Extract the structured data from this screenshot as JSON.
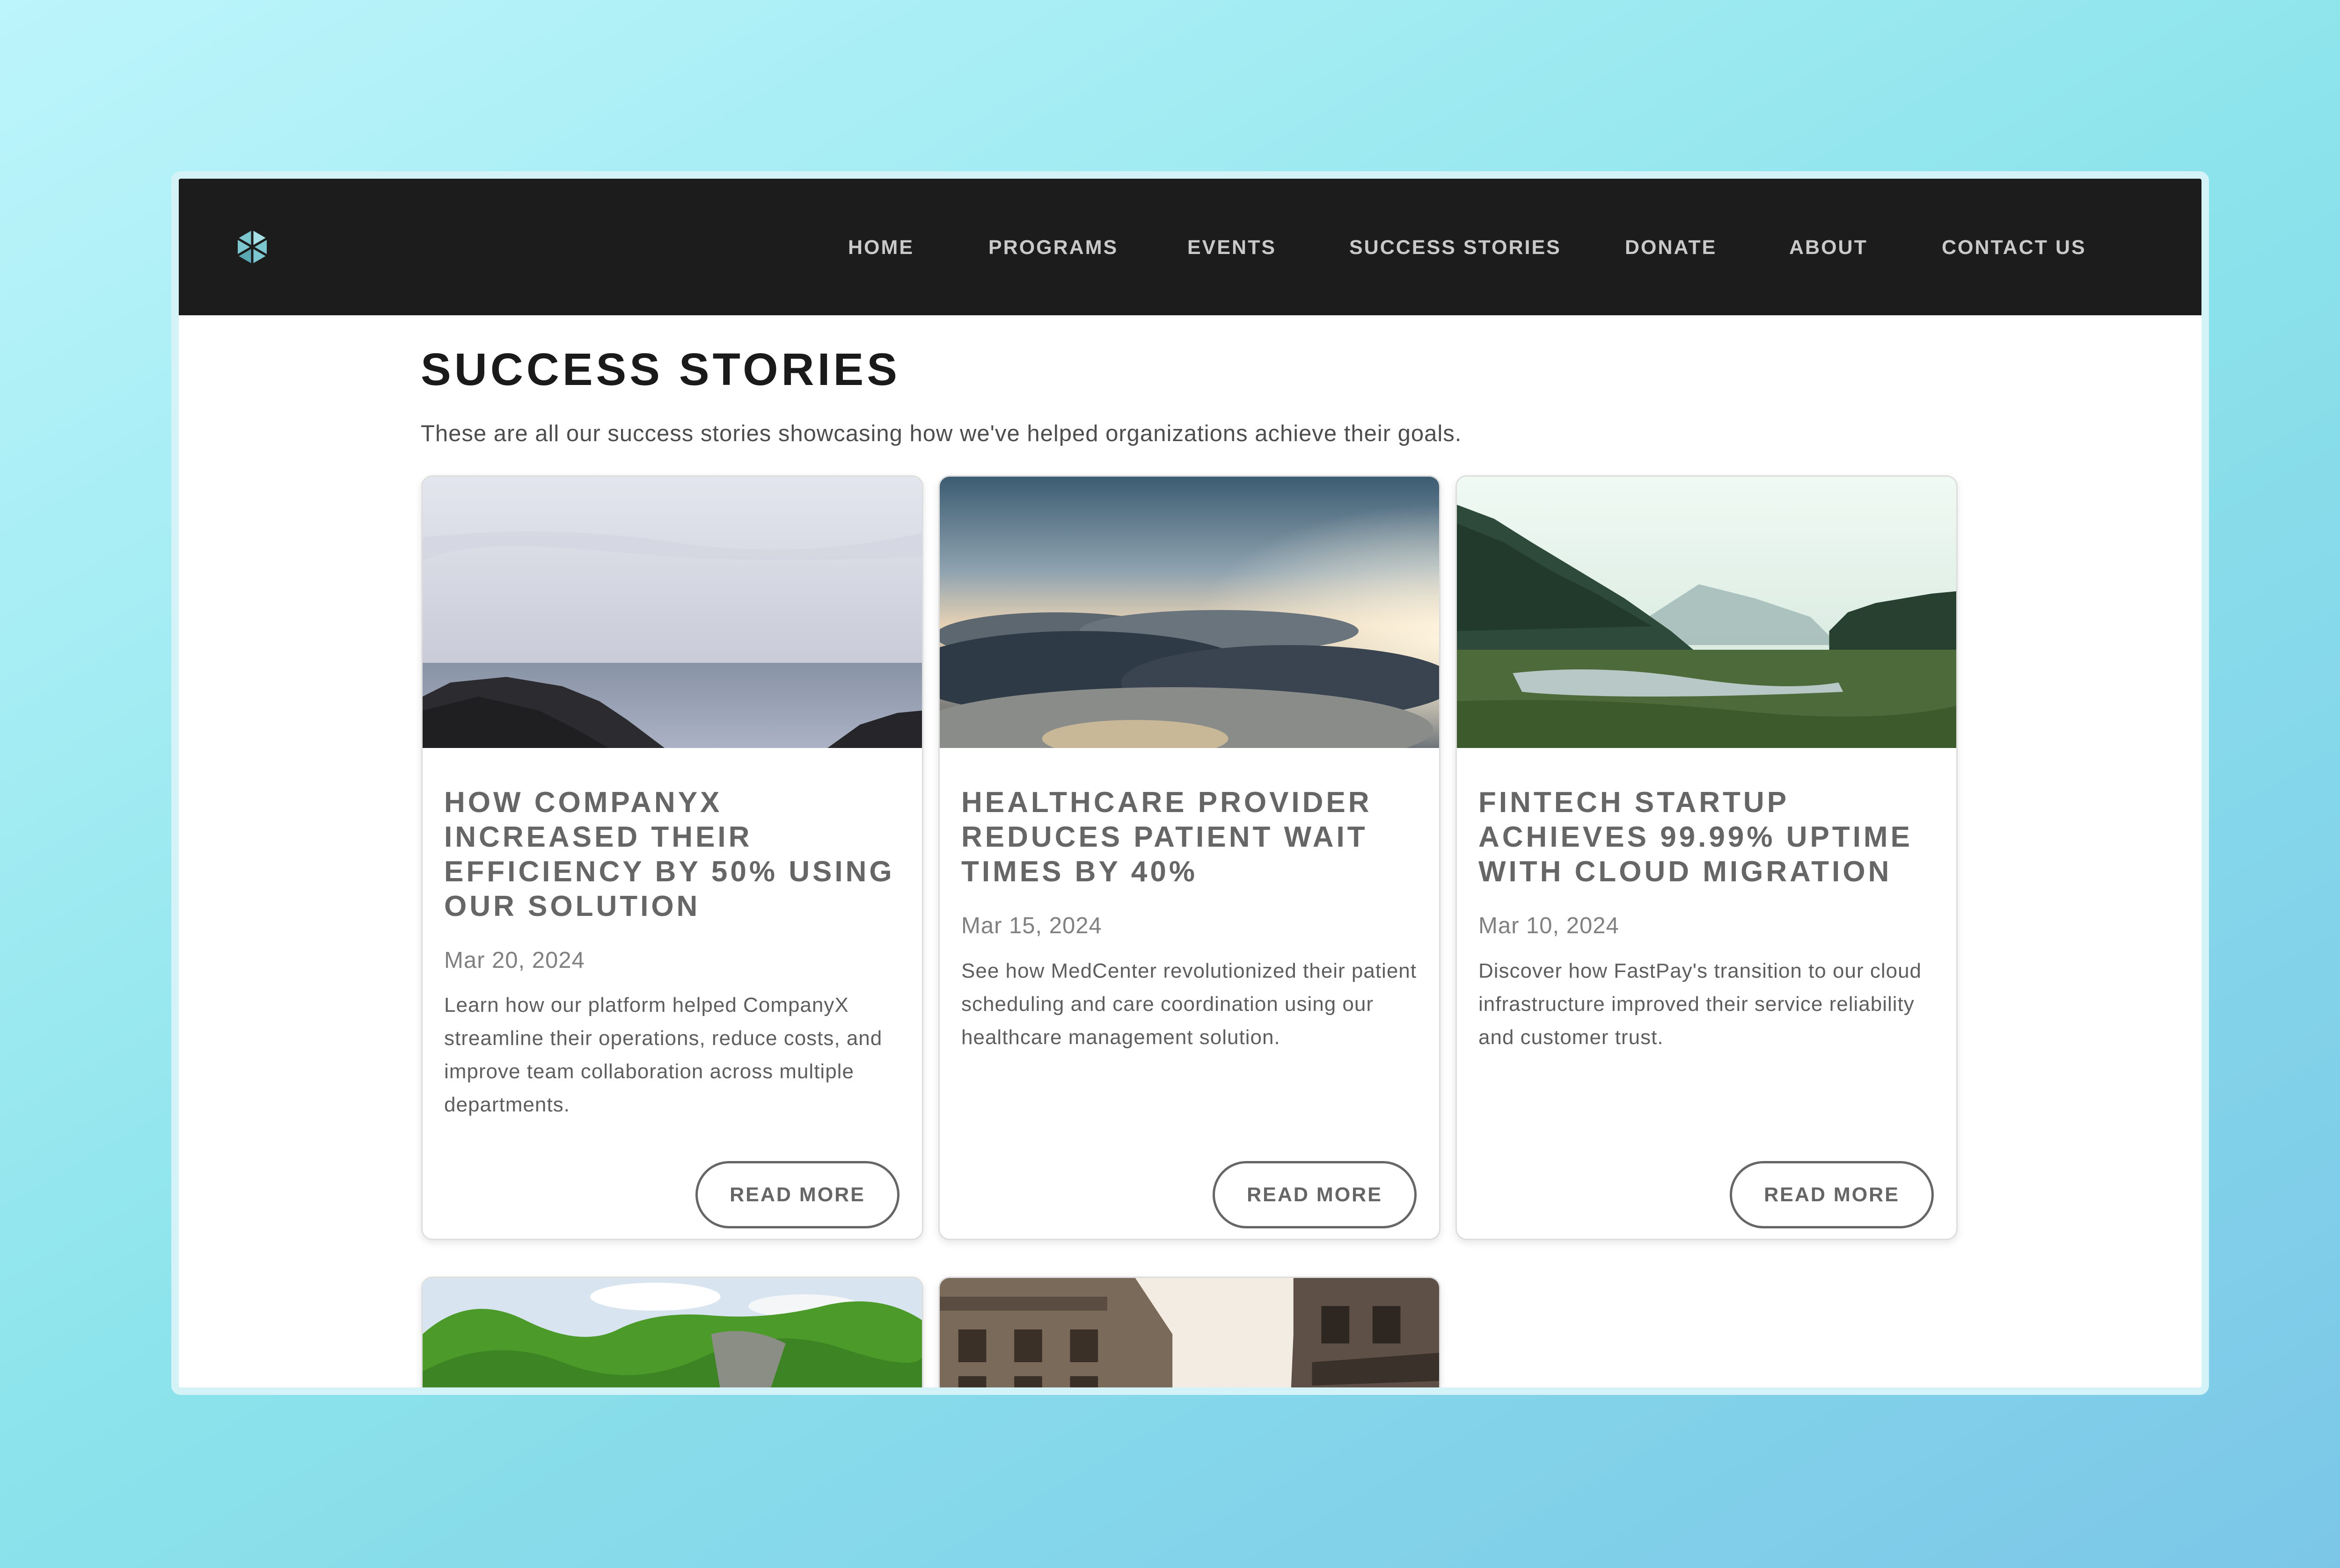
{
  "nav": {
    "logo_icon": "hexagon-logo-icon",
    "items": [
      "HOME",
      "PROGRAMS",
      "EVENTS",
      "SUCCESS STORIES",
      "DONATE",
      "ABOUT",
      "CONTACT US"
    ]
  },
  "page": {
    "title": "SUCCESS STORIES",
    "description": "These are all our success stories showcasing how we've helped organizations achieve their goals."
  },
  "cards": [
    {
      "image": "coastline-image",
      "title": "HOW COMPANYX INCREASED THEIR EFFICIENCY BY 50% USING OUR SOLUTION",
      "date": "Mar 20, 2024",
      "text": "Learn how our platform helped CompanyX streamline their operations, reduce costs, and improve team collaboration across multiple departments.",
      "button": "READ MORE"
    },
    {
      "image": "clouds-sunrise-image",
      "title": "HEALTHCARE PROVIDER REDUCES PATIENT WAIT TIMES BY 40%",
      "date": "Mar 15, 2024",
      "text": "See how MedCenter revolutionized their patient scheduling and care coordination using our healthcare management solution.",
      "button": "READ MORE"
    },
    {
      "image": "forest-river-image",
      "title": "FINTECH STARTUP ACHIEVES 99.99% UPTIME WITH CLOUD MIGRATION",
      "date": "Mar 10, 2024",
      "text": "Discover how FastPay's transition to our cloud infrastructure improved their service reliability and customer trust.",
      "button": "READ MORE"
    },
    {
      "image": "green-trees-image"
    },
    {
      "image": "city-street-image"
    }
  ],
  "colors": {
    "navbar_bg": "#1c1c1c",
    "accent_logo": "#7cc6cf",
    "nav_text": "#c9c9c9",
    "card_title": "#666666"
  }
}
